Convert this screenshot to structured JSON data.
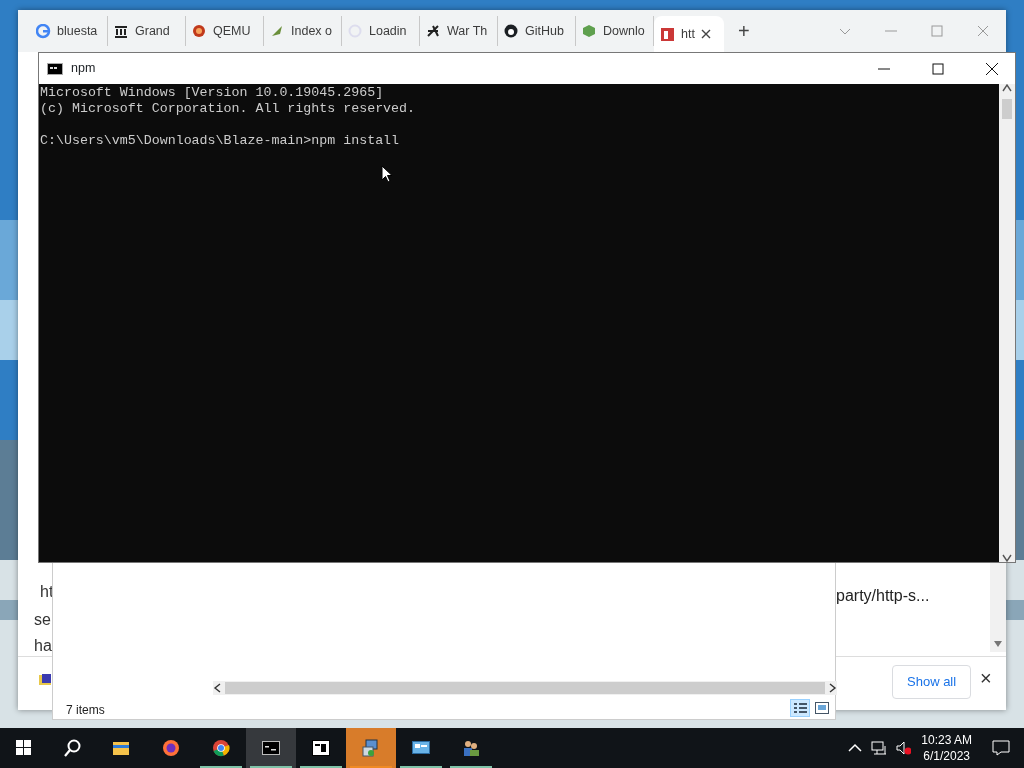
{
  "browser": {
    "tabs": [
      {
        "label": "bluesta",
        "selected": false
      },
      {
        "label": "Grand",
        "selected": false
      },
      {
        "label": "QEMU",
        "selected": false
      },
      {
        "label": "Index o",
        "selected": false
      },
      {
        "label": "Loadin",
        "selected": false
      },
      {
        "label": "War Th",
        "selected": false
      },
      {
        "label": "GitHub",
        "selected": false
      },
      {
        "label": "Downlo",
        "selected": false
      },
      {
        "label": "htt",
        "selected": true
      }
    ],
    "new_tab": "+",
    "page_fragments": [
      "ht",
      "se",
      "ha"
    ],
    "link_fragment": "party/http-s...",
    "downloads_bar": {
      "show_all": "Show all",
      "close": "×"
    }
  },
  "explorer": {
    "status": "7 items"
  },
  "console_window": {
    "title": "npm",
    "lines": [
      {
        "kind": "output",
        "text": "Microsoft Windows [Version 10.0.19045.2965]"
      },
      {
        "kind": "output",
        "text": "(c) Microsoft Corporation. All rights reserved."
      },
      {
        "kind": "command",
        "text": "C:\\Users\\vm5\\Downloads\\Blaze-main>npm install"
      }
    ]
  },
  "taskbar": {
    "apps": [
      {
        "kind": "start",
        "open": false,
        "selected": false
      },
      {
        "kind": "search",
        "open": false,
        "selected": false
      },
      {
        "kind": "folder",
        "open": false,
        "selected": false
      },
      {
        "kind": "firefox",
        "open": false,
        "selected": false
      },
      {
        "kind": "chrome",
        "open": true,
        "selected": false
      },
      {
        "kind": "console",
        "open": true,
        "selected": true
      },
      {
        "kind": "archiver",
        "open": true,
        "selected": false
      },
      {
        "kind": "installer",
        "open": true,
        "selected": false,
        "attention": true
      },
      {
        "kind": "panel",
        "open": true,
        "selected": false
      },
      {
        "kind": "users",
        "open": true,
        "selected": false
      }
    ],
    "time": "10:23 AM",
    "date": "6/1/2023"
  }
}
